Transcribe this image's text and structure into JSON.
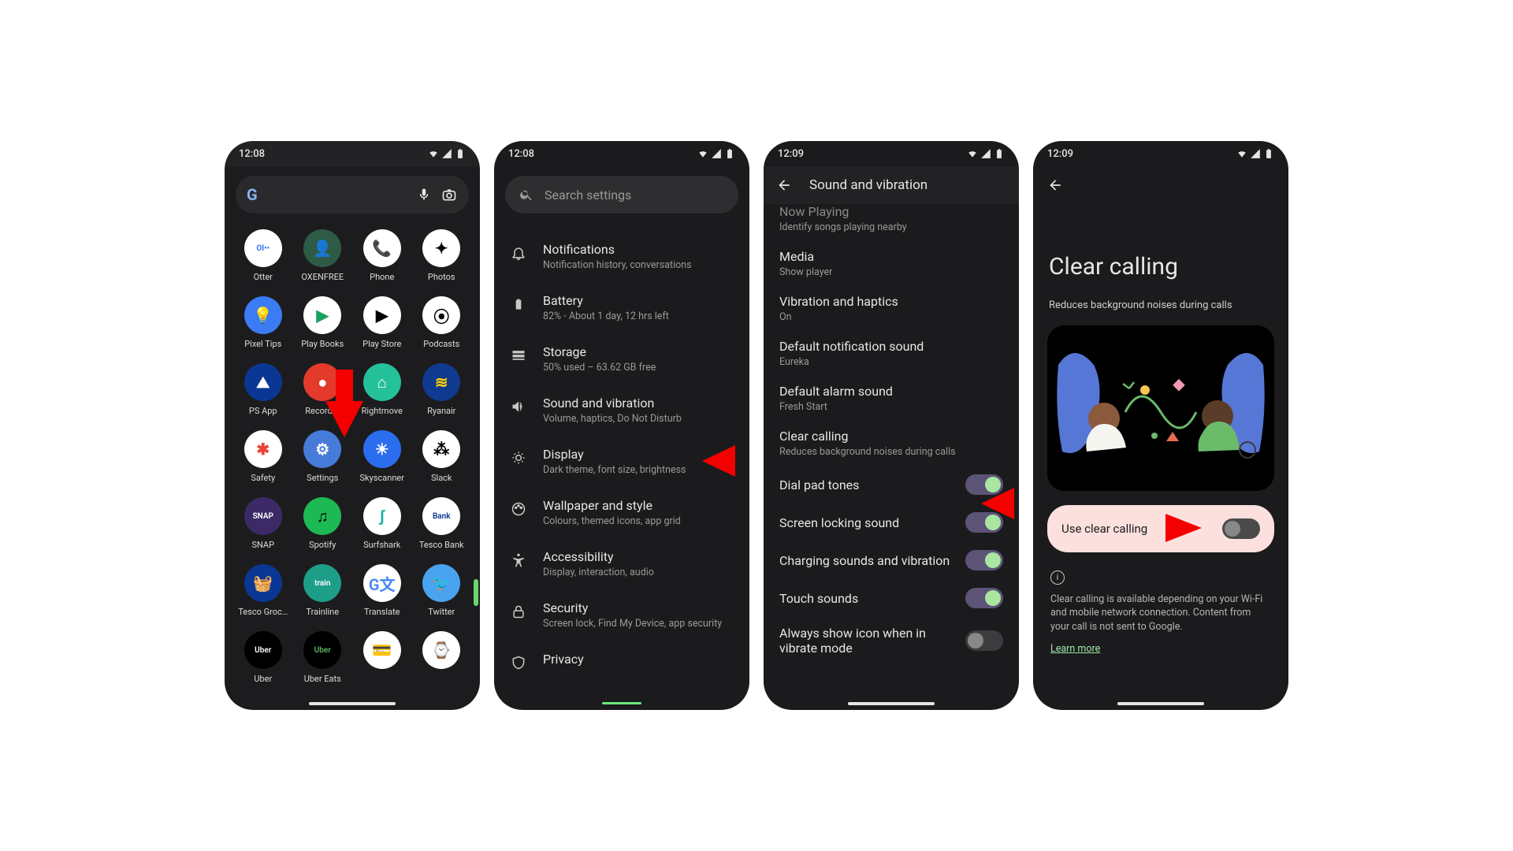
{
  "phone1": {
    "time": "12:08",
    "apps": [
      {
        "label": "Otter",
        "bg": "#ffffff",
        "fg": "#1b6cf5",
        "txt": "OI••"
      },
      {
        "label": "OXENFREE",
        "bg": "#2e5b46",
        "fg": "#fff",
        "txt": "👤"
      },
      {
        "label": "Phone",
        "bg": "#ffffff",
        "fg": "#1e6df0",
        "txt": "📞"
      },
      {
        "label": "Photos",
        "bg": "#ffffff",
        "fg": "#000",
        "txt": "✦"
      },
      {
        "label": "Pixel Tips",
        "bg": "#3b7bf3",
        "fg": "#ffd94a",
        "txt": "💡"
      },
      {
        "label": "Play Books",
        "bg": "#ffffff",
        "fg": "#1aa260",
        "txt": "▶"
      },
      {
        "label": "Play Store",
        "bg": "#ffffff",
        "fg": "#000",
        "txt": "▶"
      },
      {
        "label": "Podcasts",
        "bg": "#ffffff",
        "fg": "#000",
        "txt": "⦿"
      },
      {
        "label": "PS App",
        "bg": "#0a3794",
        "fg": "#fff",
        "txt": "⛰"
      },
      {
        "label": "Recorder",
        "bg": "#e33a2c",
        "fg": "#fff",
        "txt": "●"
      },
      {
        "label": "Rightmove",
        "bg": "#25c19a",
        "fg": "#fff",
        "txt": "⌂"
      },
      {
        "label": "Ryanair",
        "bg": "#0f3a8f",
        "fg": "#ffd400",
        "txt": "≋"
      },
      {
        "label": "Safety",
        "bg": "#ffffff",
        "fg": "#e94335",
        "txt": "✱"
      },
      {
        "label": "Settings",
        "bg": "#467bd9",
        "fg": "#fff",
        "txt": "⚙"
      },
      {
        "label": "Skyscanner",
        "bg": "#2b6def",
        "fg": "#fff",
        "txt": "☀"
      },
      {
        "label": "Slack",
        "bg": "#ffffff",
        "fg": "#000",
        "txt": "⁂"
      },
      {
        "label": "SNAP",
        "bg": "#3b2a66",
        "fg": "#fff",
        "txt": "SNAP"
      },
      {
        "label": "Spotify",
        "bg": "#1db954",
        "fg": "#000",
        "txt": "♫"
      },
      {
        "label": "Surfshark",
        "bg": "#ffffff",
        "fg": "#17b1a3",
        "txt": "ʃ"
      },
      {
        "label": "Tesco Bank",
        "bg": "#ffffff",
        "fg": "#0a3794",
        "txt": "Bank"
      },
      {
        "label": "Tesco Groc…",
        "bg": "#0a3794",
        "fg": "#fff",
        "txt": "🧺"
      },
      {
        "label": "Trainline",
        "bg": "#1c9e88",
        "fg": "#fff",
        "txt": "train"
      },
      {
        "label": "Translate",
        "bg": "#ffffff",
        "fg": "#4285f4",
        "txt": "G文"
      },
      {
        "label": "Twitter",
        "bg": "#4aa3ef",
        "fg": "#fff",
        "txt": "🐦"
      },
      {
        "label": "Uber",
        "bg": "#000000",
        "fg": "#fff",
        "txt": "Uber"
      },
      {
        "label": "Uber Eats",
        "bg": "#000000",
        "fg": "#5fb55f",
        "txt": "Uber"
      },
      {
        "label": "",
        "bg": "#ffffff",
        "fg": "#000",
        "txt": "💳"
      },
      {
        "label": "",
        "bg": "#ffffff",
        "fg": "#f6b400",
        "txt": "⌚"
      }
    ]
  },
  "phone2": {
    "time": "12:08",
    "search_placeholder": "Search settings",
    "items": [
      {
        "title": "Notifications",
        "sub": "Notification history, conversations",
        "icon": "bell"
      },
      {
        "title": "Battery",
        "sub": "82% - About 1 day, 12 hrs left",
        "icon": "battery"
      },
      {
        "title": "Storage",
        "sub": "50% used – 63.62 GB free",
        "icon": "storage"
      },
      {
        "title": "Sound and vibration",
        "sub": "Volume, haptics, Do Not Disturb",
        "icon": "sound"
      },
      {
        "title": "Display",
        "sub": "Dark theme, font size, brightness",
        "icon": "display"
      },
      {
        "title": "Wallpaper and style",
        "sub": "Colours, themed icons, app grid",
        "icon": "palette"
      },
      {
        "title": "Accessibility",
        "sub": "Display, interaction, audio",
        "icon": "a11y"
      },
      {
        "title": "Security",
        "sub": "Screen lock, Find My Device, app security",
        "icon": "lock"
      },
      {
        "title": "Privacy",
        "sub": "",
        "icon": "privacy"
      }
    ]
  },
  "phone3": {
    "time": "12:09",
    "title": "Sound and vibration",
    "items": [
      {
        "title": "Now Playing",
        "sub": "Identify songs playing nearby",
        "faded": true
      },
      {
        "title": "Media",
        "sub": "Show player"
      },
      {
        "title": "Vibration and haptics",
        "sub": "On"
      },
      {
        "title": "Default notification sound",
        "sub": "Eureka"
      },
      {
        "title": "Default alarm sound",
        "sub": "Fresh Start"
      },
      {
        "title": "Clear calling",
        "sub": "Reduces background noises during calls"
      }
    ],
    "toggles": [
      {
        "title": "Dial pad tones",
        "on": true
      },
      {
        "title": "Screen locking sound",
        "on": true
      },
      {
        "title": "Charging sounds and vibration",
        "on": true
      },
      {
        "title": "Touch sounds",
        "on": true
      },
      {
        "title": "Always show icon when in vibrate mode",
        "on": false
      }
    ]
  },
  "phone4": {
    "time": "12:09",
    "title": "Clear calling",
    "subtitle": "Reduces background noises during calls",
    "card_label": "Use clear calling",
    "card_on": false,
    "footer": "Clear calling is available depending on your Wi-Fi and mobile network connection. Content from your call is not sent to Google.",
    "learn": "Learn more"
  }
}
